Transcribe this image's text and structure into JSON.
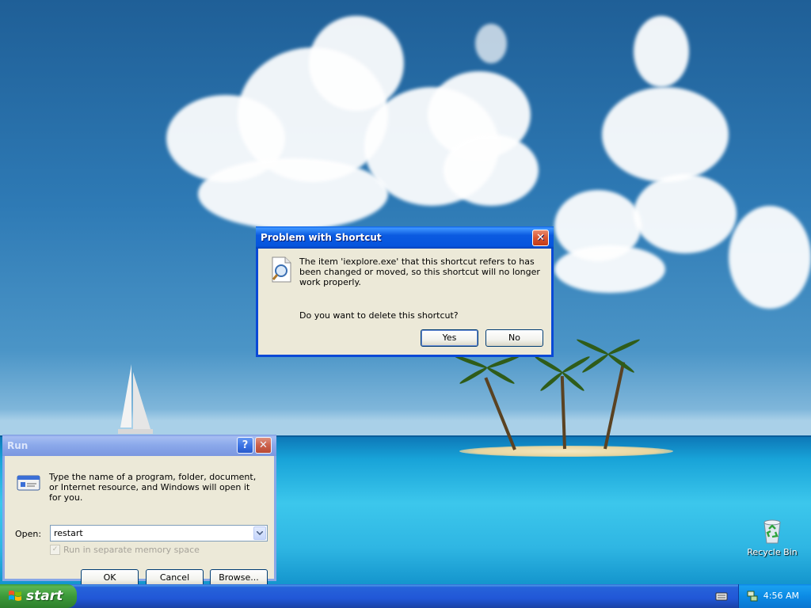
{
  "shortcut_dialog": {
    "title": "Problem with Shortcut",
    "message": "The item 'iexplore.exe' that this shortcut refers to has been changed or moved, so this shortcut will no longer work properly.",
    "question": "Do you want to delete this shortcut?",
    "yes_label": "Yes",
    "no_label": "No",
    "icon": "magnifier-question-icon"
  },
  "run_dialog": {
    "title": "Run",
    "description": "Type the name of a program, folder, document, or Internet resource, and Windows will open it for you.",
    "open_label": "Open:",
    "open_value": "restart",
    "checkbox_label": "Run in separate memory space",
    "checkbox_checked": true,
    "checkbox_enabled": false,
    "ok_label": "OK",
    "cancel_label": "Cancel",
    "browse_label": "Browse...",
    "help_symbol": "?",
    "close_symbol": "✕"
  },
  "desktop": {
    "icons": [
      {
        "label": "Recycle Bin",
        "icon": "recycle-bin-icon"
      }
    ]
  },
  "taskbar": {
    "start_label": "start",
    "clock": "4:56 AM",
    "tray_icons": [
      "keyboard-icon",
      "network-icon"
    ]
  },
  "colors": {
    "title_active": "#0a5fe6",
    "title_inactive": "#7b99e1",
    "dialog_face": "#ece9d8",
    "close_button": "#d8542f",
    "start_button": "#3c9a3a",
    "taskbar": "#2157d7"
  }
}
